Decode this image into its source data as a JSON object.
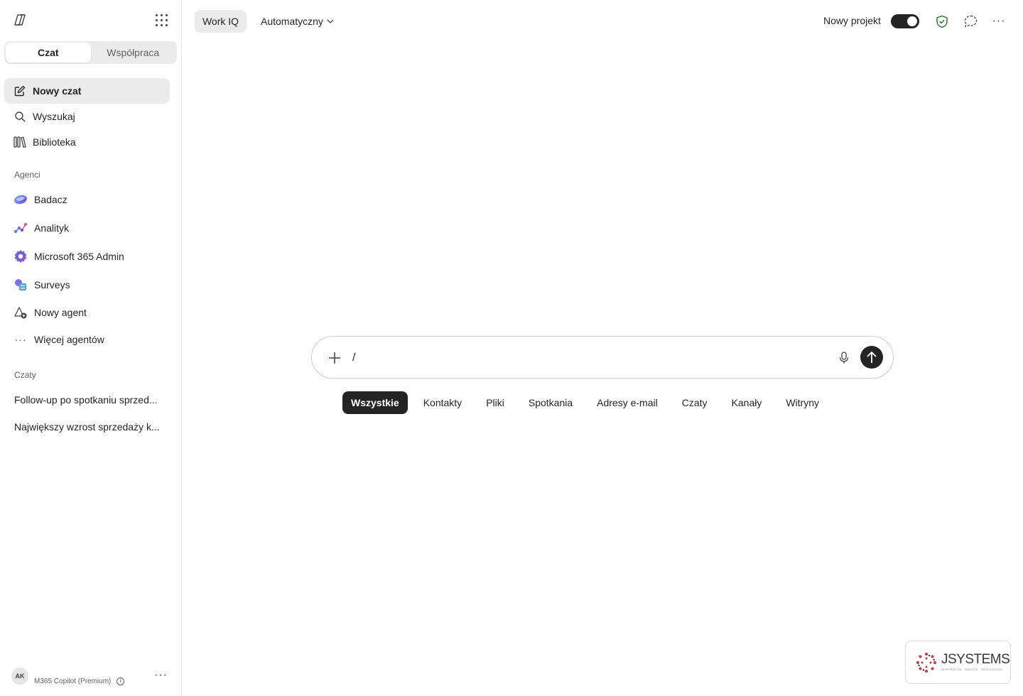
{
  "sidebar": {
    "tabs": [
      "Czat",
      "Współpraca"
    ],
    "nav": [
      "Nowy czat",
      "Wyszukaj",
      "Biblioteka"
    ],
    "agents_label": "Agenci",
    "agents": [
      "Badacz",
      "Analityk",
      "Microsoft 365 Admin",
      "Surveys",
      "Nowy agent",
      "Więcej agentów"
    ],
    "chats_label": "Czaty",
    "chats": [
      "Follow-up po spotkaniu sprzed...",
      "Największy wzrost sprzedaży k..."
    ],
    "user": {
      "initials": "AK",
      "plan": "M365 Copilot (Premium)"
    }
  },
  "topbar": {
    "work_iq": "Work IQ",
    "mode": "Automatyczny",
    "new_project": "Nowy projekt",
    "new_project_on": true
  },
  "composer": {
    "value": "/",
    "filters": [
      "Wszystkie",
      "Kontakty",
      "Pliki",
      "Spotkania",
      "Adresy e-mail",
      "Czaty",
      "Kanały",
      "Witryny"
    ],
    "active_filter": "Wszystkie"
  },
  "brand": {
    "name": "JSYSTEMS",
    "tagline": "INSPIRACJA · WIEDZA · REALIZACJA"
  },
  "icons": {
    "logo": "copilot-icon",
    "apps": "app-launcher-icon",
    "new_chat": "compose-icon",
    "search": "search-icon",
    "library": "library-icon",
    "shield": "shield-check-icon",
    "chat_bubble": "chat-bubble-icon",
    "more": "more-icon",
    "plus": "plus-icon",
    "mic": "microphone-icon",
    "send": "arrow-up-icon"
  },
  "colors": {
    "accent": "#242424",
    "shield": "#107c10",
    "brand_red": "#d13438"
  }
}
